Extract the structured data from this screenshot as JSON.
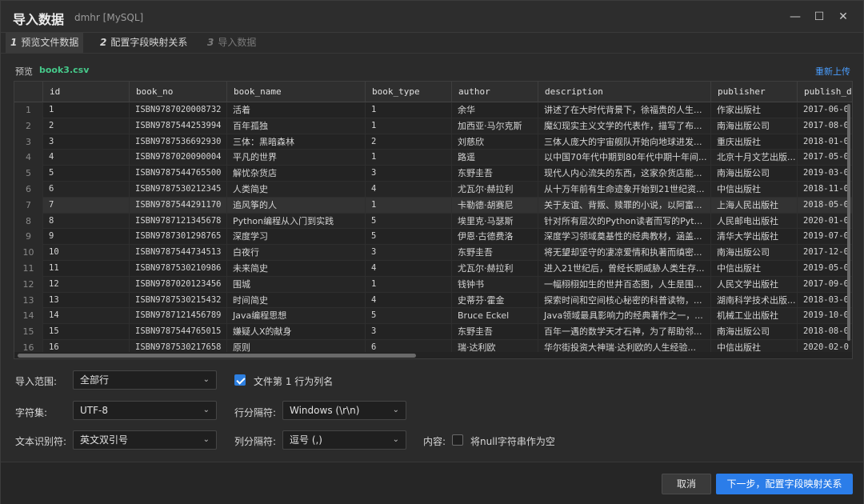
{
  "window": {
    "title": "导入数据",
    "subtitle": "dmhr [MySQL]",
    "minimize_glyph": "—",
    "maximize_glyph": "☐",
    "close_glyph": "✕"
  },
  "steps": [
    {
      "num": "1",
      "label": "预览文件数据",
      "active": true
    },
    {
      "num": "2",
      "label": "配置字段映射关系",
      "active": false
    },
    {
      "num": "3",
      "label": "导入数据",
      "active": false
    }
  ],
  "preview": {
    "label": "预览",
    "filename": "book3.csv",
    "reupload": "重新上传"
  },
  "table": {
    "columns": [
      "",
      "id",
      "book_no",
      "book_name",
      "book_type",
      "author",
      "description",
      "publisher",
      "publish_dat"
    ],
    "rows": [
      [
        "1",
        "1",
        "ISBN9787020008732",
        "活着",
        "1",
        "余华",
        "讲述了在大时代背景下，徐福贵的人生...",
        "作家出版社",
        "2017-06-0"
      ],
      [
        "2",
        "2",
        "ISBN9787544253994",
        "百年孤独",
        "1",
        "加西亚·马尔克斯",
        "魔幻现实主义文学的代表作，描写了布...",
        "南海出版公司",
        "2017-08-0"
      ],
      [
        "3",
        "3",
        "ISBN9787536692930",
        "三体：黑暗森林",
        "2",
        "刘慈欣",
        "三体人庞大的宇宙舰队开始向地球进发...",
        "重庆出版社",
        "2018-01-0"
      ],
      [
        "4",
        "4",
        "ISBN9787020090004",
        "平凡的世界",
        "1",
        "路遥",
        "以中国70年代中期到80年代中期十年间...",
        "北京十月文艺出版...",
        "2017-05-0"
      ],
      [
        "5",
        "5",
        "ISBN9787544765500",
        "解忧杂货店",
        "3",
        "东野圭吾",
        "现代人内心流失的东西，这家杂货店能...",
        "南海出版公司",
        "2019-03-0"
      ],
      [
        "6",
        "6",
        "ISBN9787530212345",
        "人类简史",
        "4",
        "尤瓦尔·赫拉利",
        "从十万年前有生命迹象开始到21世纪资...",
        "中信出版社",
        "2018-11-0"
      ],
      [
        "7",
        "7",
        "ISBN9787544291170",
        "追风筝的人",
        "1",
        "卡勒德·胡赛尼",
        "关于友谊、背叛、赎罪的小说，以阿富...",
        "上海人民出版社",
        "2018-05-0"
      ],
      [
        "8",
        "8",
        "ISBN9787121345678",
        "Python编程从入门到实践",
        "5",
        "埃里克·马瑟斯",
        "针对所有层次的Python读者而写的Pyt...",
        "人民邮电出版社",
        "2020-01-0"
      ],
      [
        "9",
        "9",
        "ISBN9787301298765",
        "深度学习",
        "5",
        "伊恩·古德费洛",
        "深度学习领域奠基性的经典教材，涵盖...",
        "清华大学出版社",
        "2019-07-0"
      ],
      [
        "10",
        "10",
        "ISBN9787544734513",
        "白夜行",
        "3",
        "东野圭吾",
        "将无望却坚守的凄凉爱情和执著而缜密...",
        "南海出版公司",
        "2017-12-0"
      ],
      [
        "11",
        "11",
        "ISBN9787530210986",
        "未来简史",
        "4",
        "尤瓦尔·赫拉利",
        "进入21世纪后，曾经长期威胁人类生存...",
        "中信出版社",
        "2019-05-0"
      ],
      [
        "12",
        "12",
        "ISBN9787020123456",
        "围城",
        "1",
        "钱钟书",
        "一幅栩栩如生的世井百态图，人生是围...",
        "人民文学出版社",
        "2017-09-0"
      ],
      [
        "13",
        "13",
        "ISBN9787530215432",
        "时间简史",
        "4",
        "史蒂芬·霍金",
        "探索时间和空间核心秘密的科普读物，...",
        "湖南科学技术出版...",
        "2018-03-0"
      ],
      [
        "14",
        "14",
        "ISBN9787121456789",
        "Java编程思想",
        "5",
        "Bruce Eckel",
        "Java领域最具影响力的经典著作之一，...",
        "机械工业出版社",
        "2019-10-0"
      ],
      [
        "15",
        "15",
        "ISBN9787544765015",
        "嫌疑人X的献身",
        "3",
        "东野圭吾",
        "百年一遇的数学天才石神，为了帮助邻...",
        "南海出版公司",
        "2018-08-0"
      ],
      [
        "16",
        "16",
        "ISBN9787530217658",
        "原则",
        "6",
        "瑞·达利欧",
        "华尔街投资大神瑞·达利欧的人生经验...",
        "中信出版社",
        "2020-02-0"
      ]
    ]
  },
  "form": {
    "range_label": "导入范围:",
    "range_value": "全部行",
    "header_checkbox_label": "文件第 1 行为列名",
    "header_checkbox_checked": true,
    "charset_label": "字符集:",
    "charset_value": "UTF-8",
    "row_sep_label": "行分隔符:",
    "row_sep_value": "Windows (\\r\\n)",
    "text_qualifier_label": "文本识别符:",
    "text_qualifier_value": "英文双引号",
    "col_sep_label": "列分隔符:",
    "col_sep_value": "逗号 (,)",
    "content_label": "内容:",
    "null_checkbox_label": "将null字符串作为空",
    "null_checkbox_checked": false
  },
  "footer": {
    "cancel_label": "取消",
    "next_label": "下一步，配置字段映射关系"
  },
  "colors": {
    "accent": "#2b7de9",
    "filename": "#46c98a",
    "link": "#4a9eff"
  }
}
